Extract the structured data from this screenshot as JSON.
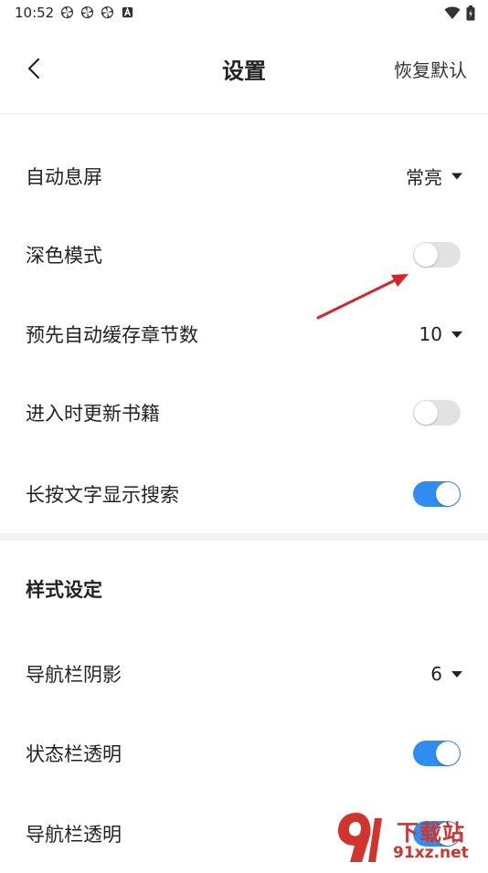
{
  "status_bar": {
    "time": "10:52",
    "notification_icons": [
      "pinwheel-icon",
      "pinwheel-icon",
      "pinwheel-icon",
      "a-badge-icon"
    ],
    "right_icons": [
      "wifi-icon",
      "battery-icon"
    ]
  },
  "header": {
    "title": "设置",
    "reset_label": "恢复默认"
  },
  "settings": {
    "auto_screen_off": {
      "label": "自动息屏",
      "value": "常亮"
    },
    "dark_mode": {
      "label": "深色模式",
      "enabled": false
    },
    "prefetch_chapters": {
      "label": "预先自动缓存章节数",
      "value": "10"
    },
    "update_on_enter": {
      "label": "进入时更新书籍",
      "enabled": false
    },
    "long_press_search": {
      "label": "长按文字显示搜索",
      "enabled": true
    }
  },
  "style_section": {
    "title": "样式设定",
    "nav_bar_shadow": {
      "label": "导航栏阴影",
      "value": "6"
    },
    "status_bar_transparent": {
      "label": "状态栏透明",
      "enabled": true
    },
    "nav_bar_transparent": {
      "label": "导航栏透明",
      "enabled": true
    }
  },
  "watermark": {
    "brand": "下载站",
    "url": "91xz.net"
  },
  "colors": {
    "toggle_on": "#2f8cf0",
    "toggle_off": "#e2e2e2",
    "annotation_arrow": "#d9222a",
    "watermark": "#d0342c"
  }
}
